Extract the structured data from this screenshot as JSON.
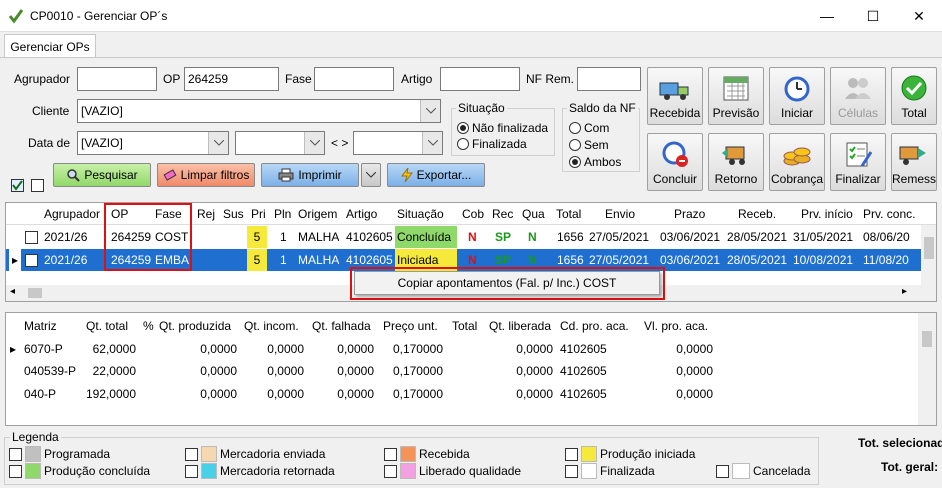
{
  "window": {
    "title": "CP0010 - Gerenciar OP´s",
    "min": "—",
    "max": "☐",
    "close": "✕"
  },
  "tab": "Gerenciar OPs",
  "filters": {
    "agrupador_label": "Agrupador",
    "agrupador_value": "",
    "op_label": "OP",
    "op_value": "264259",
    "fase_label": "Fase",
    "fase_value": "",
    "artigo_label": "Artigo",
    "artigo_value": "",
    "nfrem_label": "NF Rem.",
    "nfrem_value": "",
    "cliente_label": "Cliente",
    "cliente_value": "[VAZIO]",
    "data_label": "Data de",
    "data_value": "[VAZIO]",
    "range_sep": "< >"
  },
  "situacao": {
    "title": "Situação",
    "opt1": "Não finalizada",
    "opt2": "Finalizada"
  },
  "saldo": {
    "title": "Saldo da NF",
    "opt1": "Com",
    "opt2": "Sem",
    "opt3": "Ambos"
  },
  "actions": {
    "pesquisar": "Pesquisar",
    "limpar": "Limpar filtros",
    "imprimir": "Imprimir",
    "exportar": "Exportar..."
  },
  "toolbar": {
    "recebida": "Recebida",
    "previsao": "Previsão",
    "iniciar": "Iniciar",
    "celulas": "Células",
    "total": "Total",
    "concluir": "Concluir",
    "retorno": "Retorno",
    "cobranca": "Cobrança",
    "finalizar": "Finalizar",
    "remessa": "Remess"
  },
  "grid1": {
    "headers": [
      "Agrupador",
      "OP",
      "Fase",
      "Rej",
      "Sus",
      "Pri",
      "Pln",
      "Origem",
      "Artigo",
      "Situação",
      "Cob",
      "Rec",
      "Qua",
      "Total",
      "Envio",
      "Prazo",
      "Receb.",
      "Prv. início",
      "Prv. conc."
    ],
    "rows": [
      [
        "2021/26",
        "264259",
        "COST",
        "",
        "",
        "5",
        "1",
        "MALHA",
        "4102605",
        "Concluída",
        "N",
        "SP",
        "N",
        "1656",
        "27/05/2021",
        "03/06/2021",
        "28/05/2021",
        "31/05/2021",
        "08/06/20"
      ],
      [
        "2021/26",
        "264259",
        "EMBA",
        "",
        "",
        "5",
        "1",
        "MALHA",
        "4102605",
        "Iniciada",
        "N",
        "SP",
        "N",
        "1656",
        "27/05/2021",
        "03/06/2021",
        "28/05/2021",
        "10/08/2021",
        "11/08/20"
      ]
    ]
  },
  "context_menu": "Copiar apontamentos (Fal. p/ Inc.) COST",
  "grid2": {
    "headers": [
      "Matriz",
      "Qt. total",
      "%",
      "Qt. produzida",
      "Qt. incom.",
      "Qt. falhada",
      "Preço unt.",
      "Total",
      "Qt. liberada",
      "Cd. pro. aca.",
      "Vl. pro. aca."
    ],
    "rows": [
      [
        "6070-P",
        "62,0000",
        "",
        "0,0000",
        "0,0000",
        "0,0000",
        "0,170000",
        "",
        "0,0000",
        "4102605",
        "0,0000"
      ],
      [
        "040539-P",
        "22,0000",
        "",
        "0,0000",
        "0,0000",
        "0,0000",
        "0,170000",
        "",
        "0,0000",
        "4102605",
        "0,0000"
      ],
      [
        "040-P",
        "192,0000",
        "",
        "0,0000",
        "0,0000",
        "0,0000",
        "0,170000",
        "",
        "0,0000",
        "4102605",
        "0,0000"
      ]
    ]
  },
  "legend": {
    "title": "Legenda",
    "items": [
      {
        "label": "Programada",
        "color": "#c0c0c0"
      },
      {
        "label": "Mercadoria enviada",
        "color": "#f5d7b0"
      },
      {
        "label": "Recebida",
        "color": "#f4935a"
      },
      {
        "label": "Produção iniciada",
        "color": "#f5ea3c"
      },
      {
        "label": "Produção concluída",
        "color": "#8fd86a"
      },
      {
        "label": "Mercadoria retornada",
        "color": "#4ad0e6"
      },
      {
        "label": "Liberado qualidade",
        "color": "#f2a0e0"
      },
      {
        "label": "Finalizada",
        "color": "#ffffff"
      },
      {
        "label": "Cancelada",
        "color": "#ffffff"
      }
    ]
  },
  "totals": {
    "selected": "Tot. selecionad",
    "general": "Tot. geral:"
  },
  "colors": {
    "selected": "#1e6fd0",
    "concluida": "#8fd86a",
    "iniciada": "#f5ea3c",
    "pri": "#f5ea3c",
    "red_n": "#e01010",
    "green_sp": "#1a9a1a"
  }
}
